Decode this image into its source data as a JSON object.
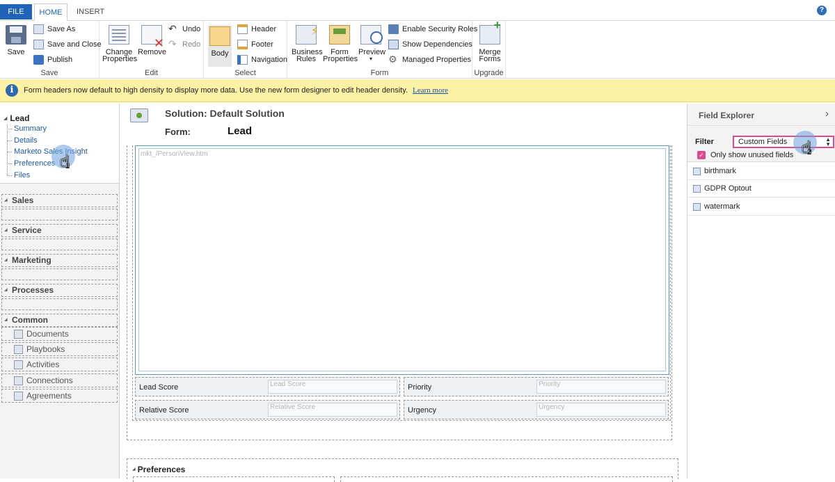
{
  "tabs": {
    "file": "FILE",
    "home": "HOME",
    "insert": "INSERT"
  },
  "help_icon": "?",
  "ribbon": {
    "save": {
      "label": "Save",
      "save_as": "Save As",
      "save_and_close": "Save and Close",
      "publish": "Publish",
      "group": "Save"
    },
    "edit": {
      "change_properties_1": "Change",
      "change_properties_2": "Properties",
      "remove": "Remove",
      "undo": "Undo",
      "redo": "Redo",
      "group": "Edit"
    },
    "select": {
      "body": "Body",
      "header": "Header",
      "footer": "Footer",
      "navigation": "Navigation",
      "group": "Select"
    },
    "form": {
      "business_rules_1": "Business",
      "business_rules_2": "Rules",
      "form_properties_1": "Form",
      "form_properties_2": "Properties",
      "preview": "Preview",
      "preview_arrow": "▾",
      "enable_security_roles": "Enable Security Roles",
      "show_dependencies": "Show Dependencies",
      "managed_properties": "Managed Properties",
      "group": "Form"
    },
    "upgrade": {
      "merge_forms_1": "Merge",
      "merge_forms_2": "Forms",
      "group": "Upgrade"
    }
  },
  "notification": {
    "message": "Form headers now default to high density to display more data. Use the new form designer to edit header density.",
    "link": "Learn more"
  },
  "leftnav": {
    "lead": {
      "title": "Lead",
      "items": [
        "Summary",
        "Details",
        "Marketo Sales Insight",
        "Preferences",
        "Files"
      ]
    },
    "sections": [
      "Sales",
      "Service",
      "Marketing",
      "Processes"
    ],
    "common": {
      "title": "Common",
      "items": [
        "Documents",
        "Playbooks",
        "Activities",
        "Connections",
        "Agreements"
      ]
    }
  },
  "main": {
    "solution_label": "Solution: Default Solution",
    "form_label": "Form:",
    "form_name": "Lead",
    "iframe_url": "mkt_/PersonView.htm",
    "fields": [
      {
        "label": "Lead Score",
        "placeholder": "Lead Score"
      },
      {
        "label": "Priority",
        "placeholder": "Priority"
      },
      {
        "label": "Relative Score",
        "placeholder": "Relative Score"
      },
      {
        "label": "Urgency",
        "placeholder": "Urgency"
      }
    ],
    "preferences_title": "Preferences"
  },
  "explorer": {
    "title": "Field Explorer",
    "chevron": "›",
    "filter_label": "Filter",
    "filter_value": "Custom Fields",
    "only_unused_label": "Only show unused fields",
    "fields": [
      "birthmark",
      "GDPR Optout",
      "watermark"
    ]
  },
  "cursors": {
    "one": "1",
    "two": "2"
  },
  "colors": {
    "accent": "#1f64b6",
    "notification_bg": "#fcf2a6",
    "filter_border": "#e04a8a",
    "checkbox": "#d94a92"
  }
}
